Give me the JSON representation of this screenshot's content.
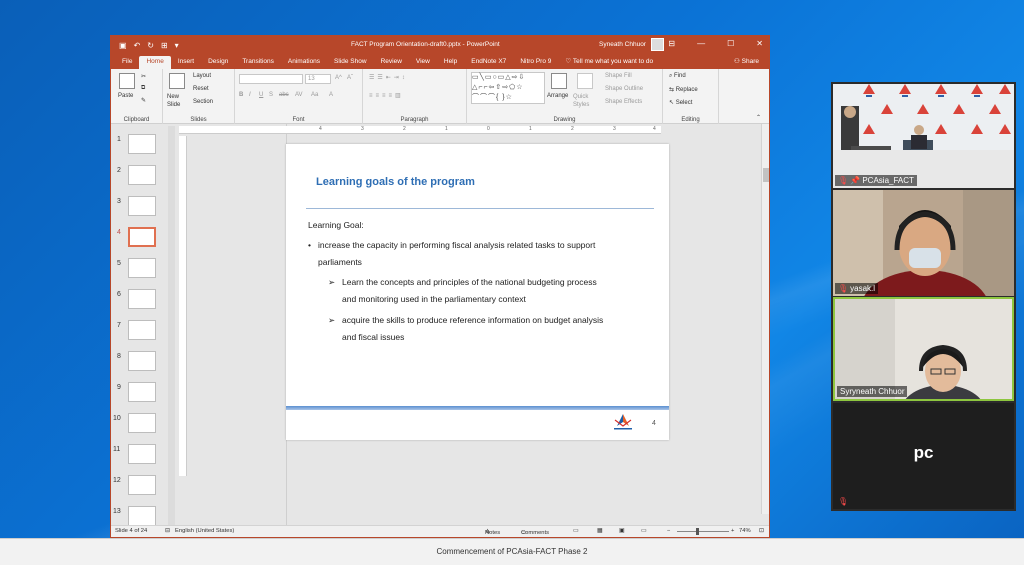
{
  "window": {
    "title": "FACT Program Orientation-draft0.pptx - PowerPoint",
    "user": "Syneath Chhuor",
    "controls": [
      "⊟",
      "—",
      "☐",
      "✕"
    ]
  },
  "ribbon_tabs": [
    "File",
    "Home",
    "Insert",
    "Design",
    "Transitions",
    "Animations",
    "Slide Show",
    "Review",
    "View",
    "Help",
    "EndNote X7",
    "Nitro Pro 9"
  ],
  "tell_me": "Tell me what you want to do",
  "share_label": "Share",
  "ribbon": {
    "clipboard": {
      "paste": "Paste",
      "label": "Clipboard"
    },
    "slides": {
      "new_slide": "New Slide",
      "layout": "Layout",
      "reset": "Reset",
      "section": "Section",
      "label": "Slides"
    },
    "font": {
      "size": "13",
      "label": "Font",
      "buttons": [
        "B",
        "I",
        "U",
        "S",
        "abc",
        "AV",
        "Aa",
        "A"
      ]
    },
    "paragraph": {
      "label": "Paragraph"
    },
    "drawing": {
      "arrange": "Arrange",
      "quick_styles": "Quick Styles",
      "shape_fill": "Shape Fill",
      "shape_outline": "Shape Outline",
      "shape_effects": "Shape Effects",
      "label": "Drawing"
    },
    "editing": {
      "find": "Find",
      "replace": "Replace",
      "select": "Select",
      "label": "Editing"
    }
  },
  "ruler_ticks": [
    "4",
    "3",
    "2",
    "1",
    "0",
    "1",
    "2",
    "3",
    "4"
  ],
  "slide_thumbnails": [
    "1",
    "2",
    "3",
    "4",
    "5",
    "6",
    "7",
    "8",
    "9",
    "10",
    "11",
    "12",
    "13"
  ],
  "selected_slide": 4,
  "slide": {
    "title": "Learning goals of the program",
    "heading": "Learning Goal:",
    "bullet1_line1": "increase the capacity in performing fiscal analysis related tasks to support",
    "bullet1_line2": "parliaments",
    "sub1_line1": "Learn the concepts and principles of the national budgeting process",
    "sub1_line2": "and monitoring used in the parliamentary context",
    "sub2_line1": "acquire the skills to produce reference information on budget analysis",
    "sub2_line2": "and fiscal issues",
    "number": "4",
    "bullet_symbol": "•",
    "sub_bullet_symbol": "➢"
  },
  "statusbar": {
    "slide_of": "Slide 4 of 24",
    "language": "English (United States)",
    "notes": "Notes",
    "comments": "Comments",
    "zoom": "74%"
  },
  "participants": [
    {
      "name": "PCAsia_FACT",
      "muted": true,
      "pinned": true
    },
    {
      "name": "yasak.l",
      "muted": true
    },
    {
      "name": "Syryneath Chhuor",
      "muted": false
    },
    {
      "name": "pc",
      "muted": true
    }
  ],
  "footer_banner": "Commencement of PCAsia-FACT Phase 2",
  "colors": {
    "accent": "#b7472a",
    "slide_title": "#2e6eb4",
    "speaker_border": "#8ec63f"
  }
}
